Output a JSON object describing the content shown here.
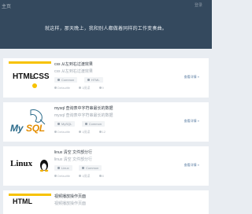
{
  "header": {
    "site_title": "主页",
    "top_right": "登录",
    "tagline": "就这样，那天晚上，我和别人都做着同样的工作变奏曲。"
  },
  "items": [
    {
      "logo": "html-css-logo",
      "title": "css 从左到右过渡效果",
      "desc": "css 从左到右过渡效果",
      "tags": [
        "Common",
        "HTML"
      ],
      "author": "Defaultfe",
      "reads": "1阅读",
      "comments": "9",
      "more": "查看详情 »"
    },
    {
      "logo": "mysql-logo",
      "title": "mysql 查询表中字符串最长的数据",
      "desc": "mysql 查询表中字符串最长的数据",
      "tags": [
        "MySQL",
        "Common"
      ],
      "author": "Defaultfe",
      "reads": "1阅读",
      "comments": "12",
      "more": "查看详情 »"
    },
    {
      "logo": "linux-logo",
      "title": "linux 清空 文件部分行",
      "desc": "linux 清空 文件部分行",
      "tags": [
        "Linux",
        "Common"
      ],
      "author": "Defaultfe",
      "reads": "1阅读",
      "comments": "8",
      "more": "查看详情 »"
    },
    {
      "logo": "html-css-logo",
      "title": "视频播放操作页面",
      "desc": "视频播放操作页面"
    }
  ],
  "logos": {
    "html_h": "HTML",
    "html_amp": "&",
    "html_css": "CSS",
    "mysql_a": "My",
    "mysql_b": "SQL",
    "linux": "Linux"
  }
}
